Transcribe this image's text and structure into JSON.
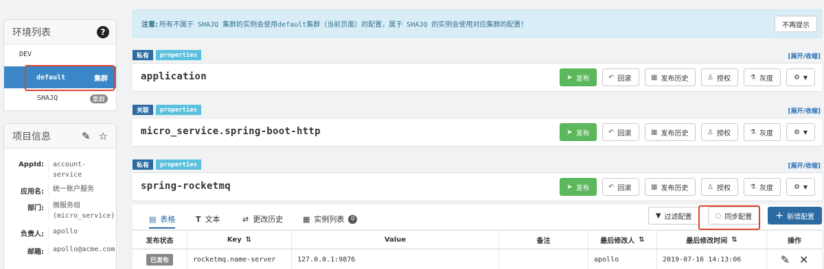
{
  "sidebar": {
    "env_title": "环境列表",
    "envs": [
      {
        "name": "DEV"
      },
      {
        "name": "default",
        "badge": "集群",
        "active": true
      },
      {
        "name": "SHAJQ",
        "badge": "集群"
      }
    ],
    "project_title": "项目信息",
    "project_info": [
      {
        "key": "AppId:",
        "value": "account-service"
      },
      {
        "key": "应用名:",
        "value": "统一账户服务"
      },
      {
        "key": "部门:",
        "value": "微服务组(micro_service)"
      },
      {
        "key": "负责人:",
        "value": "apollo"
      },
      {
        "key": "邮箱:",
        "value": "apollo@acme.com"
      }
    ]
  },
  "notice": {
    "label": "注意:",
    "text": "所有不属于 SHAJQ 集群的实例会使用default集群（当前页面）的配置，属于 SHAJQ 的实例会使用对应集群的配置！",
    "dismiss": "不再提示"
  },
  "namespaces": [
    {
      "scope": "私有",
      "format": "properties",
      "name": "application"
    },
    {
      "scope": "关联",
      "format": "properties",
      "name": "micro_service.spring-boot-http"
    },
    {
      "scope": "私有",
      "format": "properties",
      "name": "spring-rocketmq"
    }
  ],
  "ns_actions": {
    "expand": "[展开/收缩]",
    "publish": "发布",
    "rollback": "回滚",
    "history": "发布历史",
    "grant": "授权",
    "gray": "灰度"
  },
  "tabs": [
    {
      "label": "表格"
    },
    {
      "label": "文本"
    },
    {
      "label": "更改历史"
    },
    {
      "label": "实例列表",
      "count": "0"
    }
  ],
  "toolbar": {
    "filter": "过滤配置",
    "sync": "同步配置",
    "add": "新增配置"
  },
  "table": {
    "headers": [
      "发布状态",
      "Key",
      "Value",
      "备注",
      "最后修改人",
      "最后修改时间",
      "操作"
    ],
    "rows": [
      {
        "status": "已发布",
        "key": "rocketmq.name-server",
        "value": "127.0.0.1:9876",
        "comment": "",
        "modifier": "apollo",
        "time": "2019-07-16 14:13:06"
      }
    ]
  }
}
